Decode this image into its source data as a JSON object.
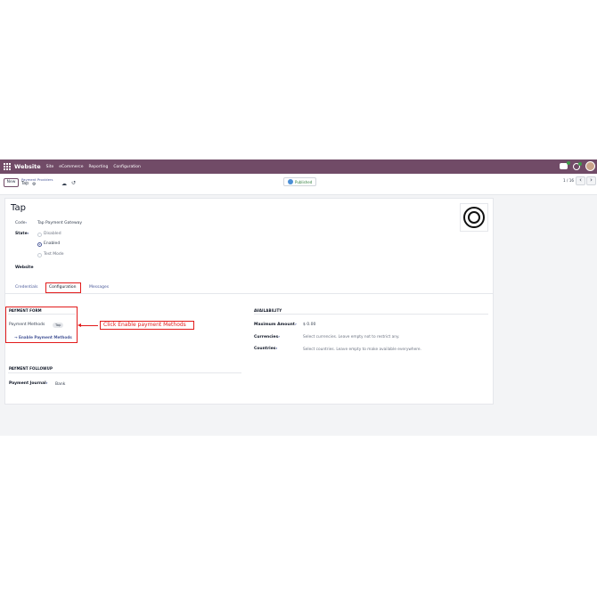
{
  "navbar": {
    "app_name": "Website",
    "menu": [
      "Site",
      "eCommerce",
      "Reporting",
      "Configuration"
    ]
  },
  "control_panel": {
    "new_label": "New",
    "breadcrumb_parent": "Payment Providers",
    "breadcrumb_current": "Tap",
    "published_label": "Published",
    "pager": "1 / 16"
  },
  "form": {
    "title": "Tap",
    "code_label": "Code",
    "code_value": "Tap Payment Gateway",
    "state_label": "State",
    "state_options": [
      "Disabled",
      "Enabled",
      "Test Mode"
    ],
    "state_selected": "Enabled",
    "website_label": "Website",
    "tabs": [
      "Credentials",
      "Configuration",
      "Messages"
    ],
    "active_tab": "Configuration"
  },
  "configuration": {
    "payment_form_title": "PAYMENT FORM",
    "payment_methods_label": "Payment Methods",
    "payment_methods_tag": "Tap",
    "enable_link": "→ Enable Payment Methods",
    "availability_title": "AVAILABILITY",
    "max_amount_label": "Maximum Amount",
    "max_amount_value": "$ 0.00",
    "currencies_label": "Currencies",
    "currencies_placeholder": "Select currencies. Leave empty not to restrict any.",
    "countries_label": "Countries",
    "countries_placeholder": "Select countries. Leave empty to make available everywhere.",
    "followup_title": "PAYMENT FOLLOWUP",
    "journal_label": "Payment Journal",
    "journal_value": "Bank"
  },
  "annotation": {
    "callout_text": "Click Enable payment Methods"
  },
  "colors": {
    "brand": "#714b67",
    "link": "#4b5a9a",
    "annotation": "#e21b1b",
    "published": "#2f7d3a"
  }
}
